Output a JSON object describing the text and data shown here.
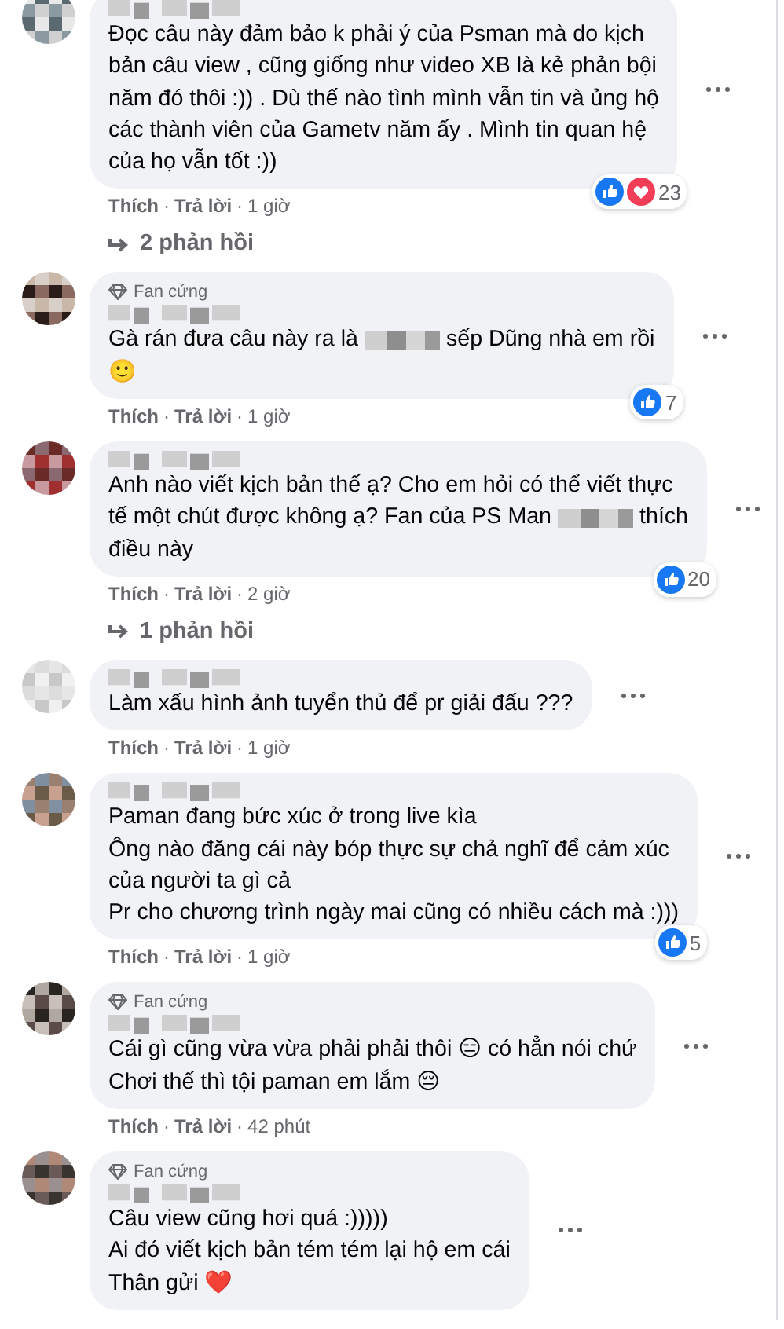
{
  "meta_separator": "·",
  "comments": [
    {
      "lines": [
        "Đọc câu này đảm bảo k phải ý của Psman mà do kịch",
        "bản câu view , cũng giống như video XB là kẻ phản bội",
        "năm đó thôi :)) . Dù thế nào tình mình vẫn tin và ủng hộ",
        "các thành viên của Gametv năm ấy . Mình tin quan hệ",
        "của họ vẫn tốt :))"
      ],
      "reactions": {
        "icons": [
          {
            "kind": "like"
          },
          {
            "kind": "love"
          }
        ],
        "count": "23"
      },
      "actions": [
        "Thích",
        "Trả lời"
      ],
      "time": "1 giờ",
      "replies": "2 phản hồi"
    },
    {
      "badge": "Fan cứng",
      "lines": [
        {
          "parts": [
            {
              "kind": "text",
              "text": "Gà rán đưa câu này ra là"
            },
            {
              "kind": "redacted"
            },
            {
              "kind": "text",
              "text": "sếp Dũng nhà em rồi"
            }
          ]
        },
        "🙂"
      ],
      "reactions": {
        "icons": [
          {
            "kind": "like"
          }
        ],
        "count": "7"
      },
      "actions": [
        "Thích",
        "Trả lời"
      ],
      "time": "1 giờ"
    },
    {
      "lines": [
        "Anh nào viết kịch bản thế ạ? Cho em hỏi có thể viết thực",
        {
          "parts": [
            {
              "kind": "text",
              "text": "tế một chút được không ạ? Fan của PS Man"
            },
            {
              "kind": "redacted"
            },
            {
              "kind": "text",
              "text": "thích"
            }
          ]
        },
        "điều này"
      ],
      "reactions": {
        "icons": [
          {
            "kind": "like"
          }
        ],
        "count": "20"
      },
      "actions": [
        "Thích",
        "Trả lời"
      ],
      "time": "2 giờ",
      "replies": "1 phản hồi"
    },
    {
      "lines": [
        "Làm xấu hình ảnh tuyển thủ để pr giải đấu ???"
      ],
      "actions": [
        "Thích",
        "Trả lời"
      ],
      "time": "1 giờ"
    },
    {
      "lines": [
        "Paman đang bức xúc ở trong live kìa",
        "Ông nào đăng cái này bóp thực sự chả nghĩ để cảm xúc",
        "của người ta gì cả",
        "Pr cho chương trình ngày mai cũng có nhiều cách mà :)))"
      ],
      "reactions": {
        "icons": [
          {
            "kind": "like"
          }
        ],
        "count": "5"
      },
      "actions": [
        "Thích",
        "Trả lời"
      ],
      "time": "1 giờ"
    },
    {
      "badge": "Fan cứng",
      "lines": [
        "Cái gì cũng vừa vừa phải phải thôi 😑 có hẳn nói chứ",
        "Chơi thế thì tội paman em lắm 😔"
      ],
      "actions": [
        "Thích",
        "Trả lời"
      ],
      "time": "42 phút"
    },
    {
      "badge": "Fan cứng",
      "lines": [
        "Câu view cũng hơi quá :)))))",
        "Ai đó viết kịch bản tém tém lại hộ em cái",
        "Thân gửi ❤️"
      ]
    }
  ]
}
